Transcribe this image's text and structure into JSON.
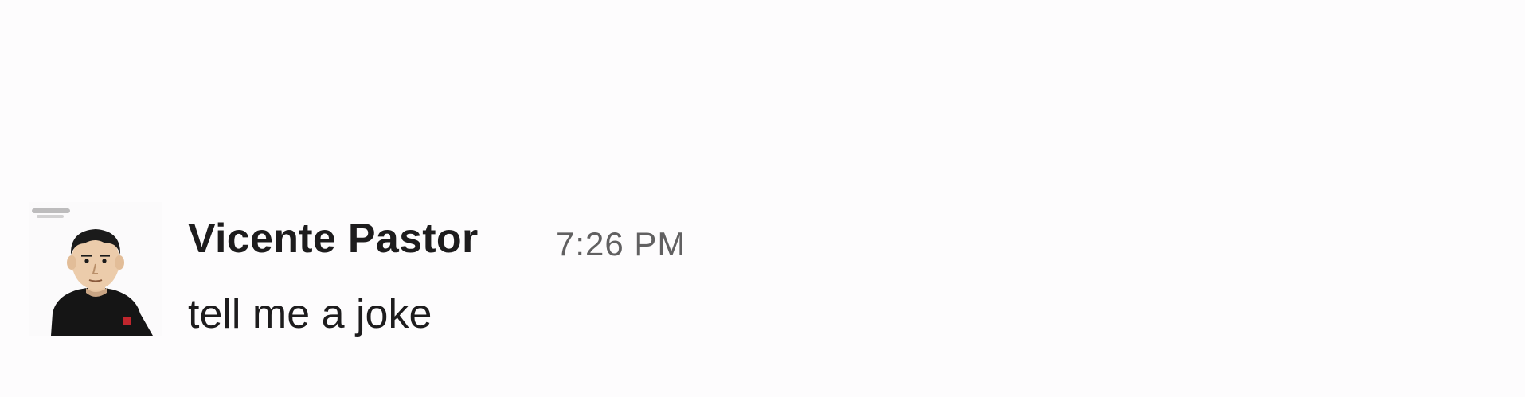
{
  "message": {
    "author": "Vicente Pastor",
    "timestamp": "7:26 PM",
    "text": "tell me a joke",
    "avatar_icon": "user-avatar-cartoon-man",
    "colors": {
      "background": "#fdfcfd",
      "author": "#1d1c1d",
      "timestamp": "#616061",
      "text": "#1d1c1d"
    }
  }
}
